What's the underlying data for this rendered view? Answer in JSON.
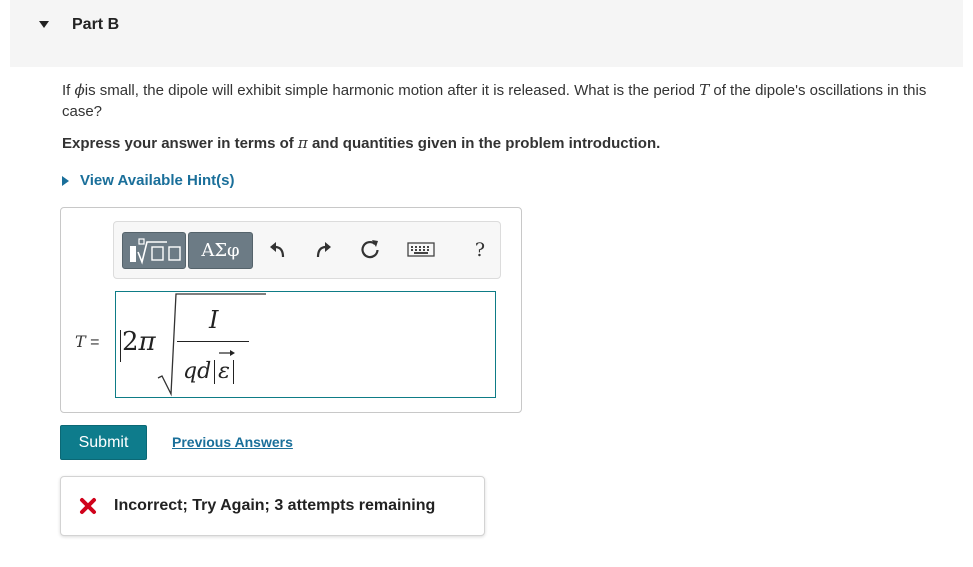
{
  "part": {
    "title": "Part B"
  },
  "question": {
    "text_before": "If ",
    "phi_symbol": "ϕ",
    "text_middle": "is small, the dipole will exhibit simple harmonic motion after it is released. What is the period ",
    "period_symbol": "T",
    "text_after": " of the dipole's oscillations in this case?"
  },
  "instruction": {
    "text_before": "Express your answer in terms of ",
    "pi_symbol": "π",
    "text_after": " and quantities given in the problem introduction."
  },
  "hint": {
    "label": "View Available Hint(s)"
  },
  "toolbar": {
    "symbols_label": "ΑΣφ",
    "help_label": "?",
    "icons": [
      "templates-icon",
      "undo-icon",
      "redo-icon",
      "reset-icon",
      "keyboard-icon",
      "help-icon"
    ]
  },
  "answer": {
    "variable": "T",
    "equals": "=",
    "coefficient_number": "2",
    "coefficient_pi": "π",
    "numerator": "I",
    "denominator_prefix": "qd",
    "denominator_vector": "ε"
  },
  "actions": {
    "submit_label": "Submit",
    "previous_answers_label": "Previous Answers"
  },
  "feedback": {
    "message": "Incorrect; Try Again; 3 attempts remaining",
    "icon": "x-mark-icon"
  },
  "colors": {
    "accent": "#0e7c8c",
    "link": "#1a6f9a",
    "error": "#d0021b",
    "toolbar_button": "#6c7b85"
  }
}
